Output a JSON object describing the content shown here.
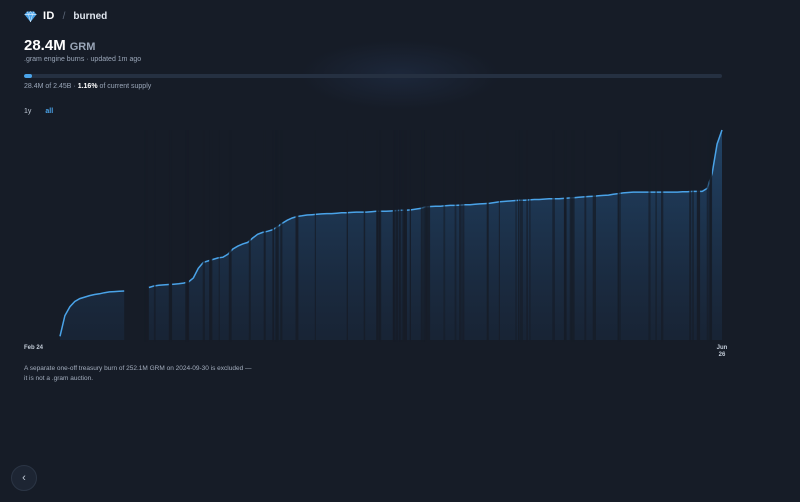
{
  "brand": {
    "name": "ID"
  },
  "breadcrumb": {
    "current": "burned"
  },
  "headline": {
    "value": "28.4M",
    "unit": "GRM"
  },
  "subline": ".gram engine burns · updated 1m ago",
  "progress": {
    "fraction": 0.0116,
    "amount_text": "28.4M of 2.45B · ",
    "percent_text": "1.16%",
    "suffix_text": " of current supply"
  },
  "range_tabs": [
    {
      "label": "1y",
      "active": false
    },
    {
      "label": "all",
      "active": true
    }
  ],
  "colors": {
    "accent": "#4aa3e8",
    "background": "#161c27",
    "area_top": "#22466b"
  },
  "chart_data": {
    "type": "area",
    "title": "",
    "xlabel": "",
    "ylabel": "",
    "x_tick_labels": [
      {
        "lines": [
          "Feb 24"
        ],
        "pos": 0.0
      },
      {
        "lines": [
          "Jun",
          "26"
        ],
        "pos": 1.0
      }
    ],
    "ylim": [
      0,
      28.4
    ],
    "y_unit": "M GRM",
    "grid": false,
    "legend": "none",
    "series": [
      {
        "values": [
          0.5,
          3.3,
          4.5,
          5.2,
          5.6,
          5.8,
          6.0,
          6.15,
          6.25,
          6.4,
          6.5,
          6.55,
          6.6,
          6.62,
          0,
          0,
          0,
          0,
          7.1,
          7.3,
          7.4,
          7.45,
          7.5,
          7.55,
          7.6,
          7.7,
          7.85,
          8.4,
          9.7,
          10.5,
          10.7,
          10.9,
          11.1,
          11.2,
          11.6,
          12.3,
          12.7,
          13.0,
          13.2,
          13.8,
          14.3,
          14.55,
          14.7,
          14.9,
          15.3,
          15.8,
          16.2,
          16.5,
          16.7,
          16.8,
          16.9,
          16.95,
          17.0,
          17.05,
          17.1,
          17.1,
          17.15,
          17.2,
          17.2,
          17.25,
          17.3,
          17.3,
          17.3,
          17.35,
          17.4,
          17.4,
          17.4,
          17.45,
          17.5,
          17.55,
          17.55,
          17.6,
          17.7,
          17.8,
          18.0,
          18.05,
          18.1,
          18.1,
          18.15,
          18.2,
          18.2,
          18.25,
          18.3,
          18.3,
          18.35,
          18.4,
          18.45,
          18.5,
          18.6,
          18.7,
          18.75,
          18.8,
          18.85,
          18.9,
          18.9,
          18.95,
          19.0,
          19.0,
          19.05,
          19.1,
          19.1,
          19.1,
          19.15,
          19.2,
          19.25,
          19.3,
          19.35,
          19.4,
          19.45,
          19.5,
          19.55,
          19.6,
          19.7,
          19.8,
          19.9,
          19.95,
          20.0,
          20.0,
          20.0,
          20.0,
          20.0,
          20.0,
          20.0,
          20.0,
          20.0,
          20.0,
          20.05,
          20.05,
          20.1,
          20.1,
          20.1,
          20.5,
          22.5,
          26.5,
          28.4
        ]
      }
    ],
    "annotations": []
  },
  "footnote": {
    "line1": "A separate one-off treasury burn of 252.1M GRM on 2024-09-30 is excluded —",
    "line2": "it is not a .gram auction."
  },
  "back_button": {
    "label": "‹"
  }
}
